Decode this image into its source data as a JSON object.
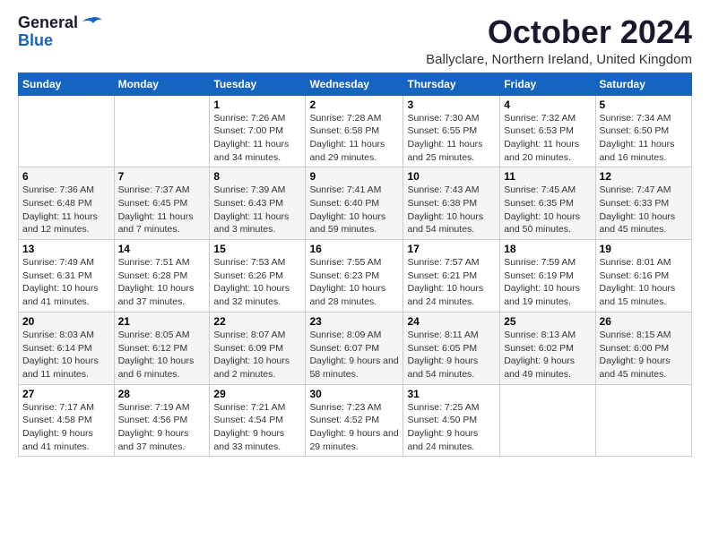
{
  "header": {
    "logo_line1": "General",
    "logo_line2": "Blue",
    "month_title": "October 2024",
    "location": "Ballyclare, Northern Ireland, United Kingdom"
  },
  "days_of_week": [
    "Sunday",
    "Monday",
    "Tuesday",
    "Wednesday",
    "Thursday",
    "Friday",
    "Saturday"
  ],
  "weeks": [
    [
      {
        "day": "",
        "sunrise": "",
        "sunset": "",
        "daylight": ""
      },
      {
        "day": "",
        "sunrise": "",
        "sunset": "",
        "daylight": ""
      },
      {
        "day": "1",
        "sunrise": "Sunrise: 7:26 AM",
        "sunset": "Sunset: 7:00 PM",
        "daylight": "Daylight: 11 hours and 34 minutes."
      },
      {
        "day": "2",
        "sunrise": "Sunrise: 7:28 AM",
        "sunset": "Sunset: 6:58 PM",
        "daylight": "Daylight: 11 hours and 29 minutes."
      },
      {
        "day": "3",
        "sunrise": "Sunrise: 7:30 AM",
        "sunset": "Sunset: 6:55 PM",
        "daylight": "Daylight: 11 hours and 25 minutes."
      },
      {
        "day": "4",
        "sunrise": "Sunrise: 7:32 AM",
        "sunset": "Sunset: 6:53 PM",
        "daylight": "Daylight: 11 hours and 20 minutes."
      },
      {
        "day": "5",
        "sunrise": "Sunrise: 7:34 AM",
        "sunset": "Sunset: 6:50 PM",
        "daylight": "Daylight: 11 hours and 16 minutes."
      }
    ],
    [
      {
        "day": "6",
        "sunrise": "Sunrise: 7:36 AM",
        "sunset": "Sunset: 6:48 PM",
        "daylight": "Daylight: 11 hours and 12 minutes."
      },
      {
        "day": "7",
        "sunrise": "Sunrise: 7:37 AM",
        "sunset": "Sunset: 6:45 PM",
        "daylight": "Daylight: 11 hours and 7 minutes."
      },
      {
        "day": "8",
        "sunrise": "Sunrise: 7:39 AM",
        "sunset": "Sunset: 6:43 PM",
        "daylight": "Daylight: 11 hours and 3 minutes."
      },
      {
        "day": "9",
        "sunrise": "Sunrise: 7:41 AM",
        "sunset": "Sunset: 6:40 PM",
        "daylight": "Daylight: 10 hours and 59 minutes."
      },
      {
        "day": "10",
        "sunrise": "Sunrise: 7:43 AM",
        "sunset": "Sunset: 6:38 PM",
        "daylight": "Daylight: 10 hours and 54 minutes."
      },
      {
        "day": "11",
        "sunrise": "Sunrise: 7:45 AM",
        "sunset": "Sunset: 6:35 PM",
        "daylight": "Daylight: 10 hours and 50 minutes."
      },
      {
        "day": "12",
        "sunrise": "Sunrise: 7:47 AM",
        "sunset": "Sunset: 6:33 PM",
        "daylight": "Daylight: 10 hours and 45 minutes."
      }
    ],
    [
      {
        "day": "13",
        "sunrise": "Sunrise: 7:49 AM",
        "sunset": "Sunset: 6:31 PM",
        "daylight": "Daylight: 10 hours and 41 minutes."
      },
      {
        "day": "14",
        "sunrise": "Sunrise: 7:51 AM",
        "sunset": "Sunset: 6:28 PM",
        "daylight": "Daylight: 10 hours and 37 minutes."
      },
      {
        "day": "15",
        "sunrise": "Sunrise: 7:53 AM",
        "sunset": "Sunset: 6:26 PM",
        "daylight": "Daylight: 10 hours and 32 minutes."
      },
      {
        "day": "16",
        "sunrise": "Sunrise: 7:55 AM",
        "sunset": "Sunset: 6:23 PM",
        "daylight": "Daylight: 10 hours and 28 minutes."
      },
      {
        "day": "17",
        "sunrise": "Sunrise: 7:57 AM",
        "sunset": "Sunset: 6:21 PM",
        "daylight": "Daylight: 10 hours and 24 minutes."
      },
      {
        "day": "18",
        "sunrise": "Sunrise: 7:59 AM",
        "sunset": "Sunset: 6:19 PM",
        "daylight": "Daylight: 10 hours and 19 minutes."
      },
      {
        "day": "19",
        "sunrise": "Sunrise: 8:01 AM",
        "sunset": "Sunset: 6:16 PM",
        "daylight": "Daylight: 10 hours and 15 minutes."
      }
    ],
    [
      {
        "day": "20",
        "sunrise": "Sunrise: 8:03 AM",
        "sunset": "Sunset: 6:14 PM",
        "daylight": "Daylight: 10 hours and 11 minutes."
      },
      {
        "day": "21",
        "sunrise": "Sunrise: 8:05 AM",
        "sunset": "Sunset: 6:12 PM",
        "daylight": "Daylight: 10 hours and 6 minutes."
      },
      {
        "day": "22",
        "sunrise": "Sunrise: 8:07 AM",
        "sunset": "Sunset: 6:09 PM",
        "daylight": "Daylight: 10 hours and 2 minutes."
      },
      {
        "day": "23",
        "sunrise": "Sunrise: 8:09 AM",
        "sunset": "Sunset: 6:07 PM",
        "daylight": "Daylight: 9 hours and 58 minutes."
      },
      {
        "day": "24",
        "sunrise": "Sunrise: 8:11 AM",
        "sunset": "Sunset: 6:05 PM",
        "daylight": "Daylight: 9 hours and 54 minutes."
      },
      {
        "day": "25",
        "sunrise": "Sunrise: 8:13 AM",
        "sunset": "Sunset: 6:02 PM",
        "daylight": "Daylight: 9 hours and 49 minutes."
      },
      {
        "day": "26",
        "sunrise": "Sunrise: 8:15 AM",
        "sunset": "Sunset: 6:00 PM",
        "daylight": "Daylight: 9 hours and 45 minutes."
      }
    ],
    [
      {
        "day": "27",
        "sunrise": "Sunrise: 7:17 AM",
        "sunset": "Sunset: 4:58 PM",
        "daylight": "Daylight: 9 hours and 41 minutes."
      },
      {
        "day": "28",
        "sunrise": "Sunrise: 7:19 AM",
        "sunset": "Sunset: 4:56 PM",
        "daylight": "Daylight: 9 hours and 37 minutes."
      },
      {
        "day": "29",
        "sunrise": "Sunrise: 7:21 AM",
        "sunset": "Sunset: 4:54 PM",
        "daylight": "Daylight: 9 hours and 33 minutes."
      },
      {
        "day": "30",
        "sunrise": "Sunrise: 7:23 AM",
        "sunset": "Sunset: 4:52 PM",
        "daylight": "Daylight: 9 hours and 29 minutes."
      },
      {
        "day": "31",
        "sunrise": "Sunrise: 7:25 AM",
        "sunset": "Sunset: 4:50 PM",
        "daylight": "Daylight: 9 hours and 24 minutes."
      },
      {
        "day": "",
        "sunrise": "",
        "sunset": "",
        "daylight": ""
      },
      {
        "day": "",
        "sunrise": "",
        "sunset": "",
        "daylight": ""
      }
    ]
  ]
}
